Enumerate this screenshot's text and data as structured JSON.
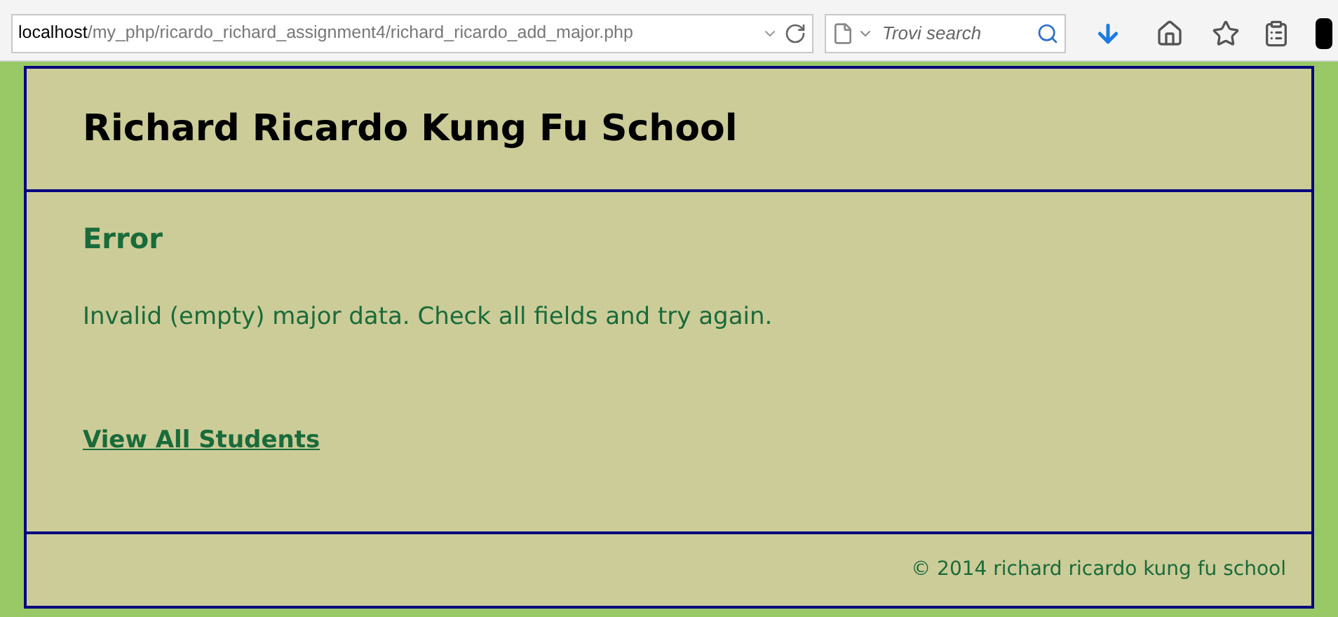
{
  "browser": {
    "url_host": "localhost",
    "url_path": "/my_php/ricardo_richard_assignment4/richard_ricardo_add_major.php",
    "search_placeholder": "Trovi search"
  },
  "header": {
    "title": "Richard Ricardo Kung Fu School"
  },
  "content": {
    "heading": "Error",
    "message": "Invalid (empty) major data. Check all fields and try again.",
    "link": "View All Students"
  },
  "footer": {
    "text": "© 2014 richard ricardo kung fu school"
  }
}
